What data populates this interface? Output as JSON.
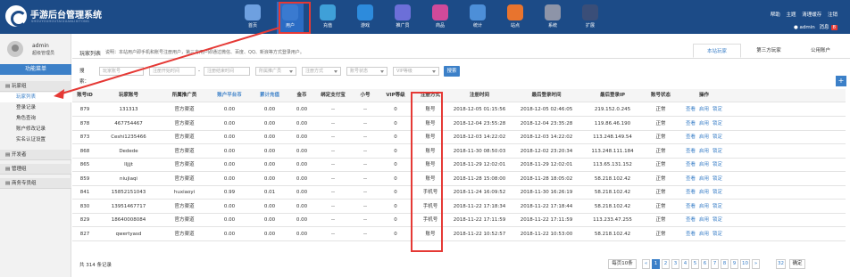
{
  "header": {
    "brand": "手游后台管理系统",
    "brand_sub": "SHOUYOUHOUTAIGUANLIXITONG",
    "nav": [
      {
        "label": "首页",
        "icon": "home-icon",
        "color": "#6ea0e0"
      },
      {
        "label": "用户",
        "icon": "user-icon",
        "color": "#3a7ad0"
      },
      {
        "label": "充值",
        "icon": "recharge-icon",
        "color": "#3fa0d8"
      },
      {
        "label": "游戏",
        "icon": "game-icon",
        "color": "#2d8bdc"
      },
      {
        "label": "推广员",
        "icon": "promoter-icon",
        "color": "#6c6fd8"
      },
      {
        "label": "商品",
        "icon": "goods-icon",
        "color": "#d04a9a"
      },
      {
        "label": "统计",
        "icon": "stats-icon",
        "color": "#4d8fd8"
      },
      {
        "label": "站点",
        "icon": "site-icon",
        "color": "#e8742e"
      },
      {
        "label": "系统",
        "icon": "system-icon",
        "color": "#8d94a8"
      },
      {
        "label": "扩展",
        "icon": "extend-icon",
        "color": "#3a4e78"
      }
    ],
    "links": [
      "帮助",
      "主题",
      "清理缓存",
      "注销"
    ],
    "user": "admin",
    "messages_label": "消息",
    "messages_count": "8"
  },
  "sidebar": {
    "username": "admin",
    "role": "超级管理员",
    "menu_header": "功能菜单",
    "groups": [
      {
        "label": "玩家组"
      },
      {
        "label": "开发者"
      },
      {
        "label": "管理组"
      },
      {
        "label": "商务专员组"
      }
    ],
    "items": [
      "玩家列表",
      "登录记录",
      "角色查询",
      "账户修改记录",
      "实名认证设置"
    ]
  },
  "page": {
    "title": "玩家列表",
    "note": "说明：本站用户即手机和账号注册用户，第三方用户即通过微信、百度、QQ、新浪等方式登录用户。",
    "tabs": [
      "本站玩家",
      "第三方玩家",
      "公用账户"
    ]
  },
  "filters": {
    "label": "搜索：",
    "account_ph": "玩家账号",
    "start_ph": "注册开始时间",
    "end_ph": "注册结束时间",
    "promoter_ph": "所属推广员",
    "method_ph": "注册方式",
    "status_ph": "账号状态",
    "vip_ph": "VIP等级",
    "search": "搜索",
    "dash": "-"
  },
  "table": {
    "headers": [
      "账号ID",
      "玩家账号",
      "所属推广员",
      "账户平台币",
      "累计充值",
      "金币",
      "绑定支付宝",
      "小号",
      "VIP等级",
      "注册方式",
      "注册时间",
      "最后登录时间",
      "最后登录IP",
      "账号状态",
      "操作"
    ],
    "ops": [
      "查看",
      "启用",
      "锁定"
    ],
    "rows": [
      [
        "879",
        "131313",
        "官方渠道",
        "0.00",
        "0.00",
        "0.00",
        "--",
        "--",
        "0",
        "账号",
        "2018-12-05 01:15:56",
        "2018-12-05 02:46:05",
        "219.152.0.245",
        "正常"
      ],
      [
        "878",
        "467754467",
        "官方渠道",
        "0.00",
        "0.00",
        "0.00",
        "--",
        "--",
        "0",
        "账号",
        "2018-12-04 23:55:28",
        "2018-12-04 23:35:28",
        "119.86.46.190",
        "正常"
      ],
      [
        "873",
        "Ceshi1235466",
        "官方渠道",
        "0.00",
        "0.00",
        "0.00",
        "--",
        "--",
        "0",
        "账号",
        "2018-12-03 14:22:02",
        "2018-12-03 14:22:02",
        "113.248.149.54",
        "正常"
      ],
      [
        "868",
        "Dedede",
        "官方渠道",
        "0.00",
        "0.00",
        "0.00",
        "--",
        "--",
        "0",
        "账号",
        "2018-11-30 08:50:03",
        "2018-12-02 23:20:34",
        "113.248.111.184",
        "正常"
      ],
      [
        "865",
        "lljjjt",
        "官方渠道",
        "0.00",
        "0.00",
        "0.00",
        "--",
        "--",
        "0",
        "账号",
        "2018-11-29 12:02:01",
        "2018-11-29 12:02:01",
        "113.65.131.152",
        "正常"
      ],
      [
        "859",
        "niujiaqi",
        "官方渠道",
        "0.00",
        "0.00",
        "0.00",
        "--",
        "--",
        "0",
        "账号",
        "2018-11-28 15:08:00",
        "2018-11-28 18:05:02",
        "58.218.102.42",
        "正常"
      ],
      [
        "841",
        "15852151043",
        "huxiaoyi",
        "0.99",
        "0.01",
        "0.00",
        "--",
        "--",
        "0",
        "手机号",
        "2018-11-24 16:09:52",
        "2018-11-30 16:26:19",
        "58.218.102.42",
        "正常"
      ],
      [
        "830",
        "13951467717",
        "官方渠道",
        "0.00",
        "0.00",
        "0.00",
        "--",
        "--",
        "0",
        "手机号",
        "2018-11-22 17:18:34",
        "2018-11-22 17:18:44",
        "58.218.102.42",
        "正常"
      ],
      [
        "829",
        "18640008084",
        "官方渠道",
        "0.00",
        "0.00",
        "0.00",
        "--",
        "--",
        "0",
        "手机号",
        "2018-11-22 17:11:59",
        "2018-11-22 17:11:59",
        "113.233.47.255",
        "正常"
      ],
      [
        "827",
        "qwertyasd",
        "官方渠道",
        "0.00",
        "0.00",
        "0.00",
        "--",
        "--",
        "0",
        "账号",
        "2018-11-22 10:52:57",
        "2018-11-22 10:53:00",
        "58.218.102.42",
        "正常"
      ]
    ]
  },
  "footer": {
    "total": "共 314 条记录",
    "page_size": "每页10条",
    "pages": [
      "«",
      "1",
      "2",
      "3",
      "4",
      "5",
      "6",
      "7",
      "8",
      "9",
      "10",
      "»",
      "32"
    ],
    "jump": "确定"
  },
  "colors": {
    "accent": "#3c80c8",
    "header_bg": "#1c4b87",
    "highlight": "#e53935"
  }
}
